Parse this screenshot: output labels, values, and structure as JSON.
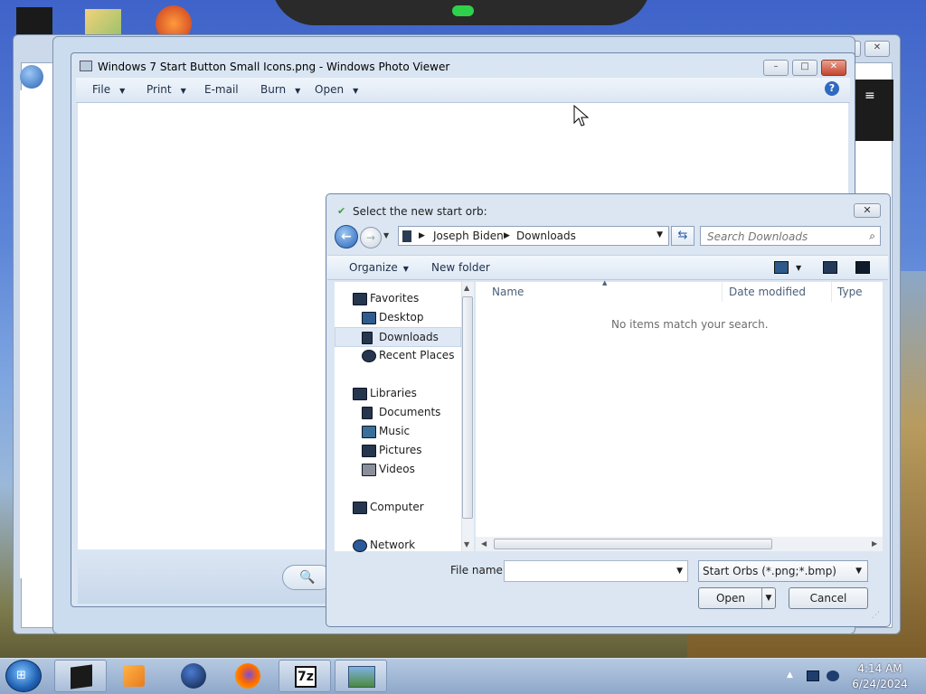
{
  "photo_viewer": {
    "title": "Windows 7 Start Button Small Icons.png - Windows Photo Viewer",
    "menu": [
      "File",
      "Print",
      "E-mail",
      "Burn",
      "Open"
    ],
    "help_label": "?"
  },
  "dialog": {
    "title": "Select the new start orb:",
    "close_label": "✕",
    "address": {
      "segments": [
        "Joseph Biden",
        "Downloads"
      ]
    },
    "search": {
      "placeholder": "Search Downloads"
    },
    "commands": {
      "organize": "Organize",
      "new_folder": "New folder"
    },
    "nav": {
      "favorites": {
        "label": "Favorites",
        "items": [
          "Desktop",
          "Downloads",
          "Recent Places"
        ],
        "selected": "Downloads"
      },
      "libraries": {
        "label": "Libraries",
        "items": [
          "Documents",
          "Music",
          "Pictures",
          "Videos"
        ]
      },
      "computer": "Computer",
      "network": "Network"
    },
    "columns": [
      "Name",
      "Date modified",
      "Type"
    ],
    "empty_message": "No items match your search.",
    "file_name_label": "File name:",
    "file_name_value": "",
    "file_type_filter": "Start Orbs (*.png;*.bmp)",
    "open_label": "Open",
    "cancel_label": "Cancel"
  },
  "taskbar": {
    "apps": [
      "file-manager",
      "media-player",
      "globe",
      "firefox",
      "7zip",
      "photo-viewer"
    ],
    "sevenzip_label": "7z",
    "clock_time": "4:14 AM",
    "clock_date": "6/24/2024"
  },
  "colors": {
    "accent": "#2a62b5",
    "window_frame": "#cbdcee",
    "taskbar": "#a4bad8"
  }
}
